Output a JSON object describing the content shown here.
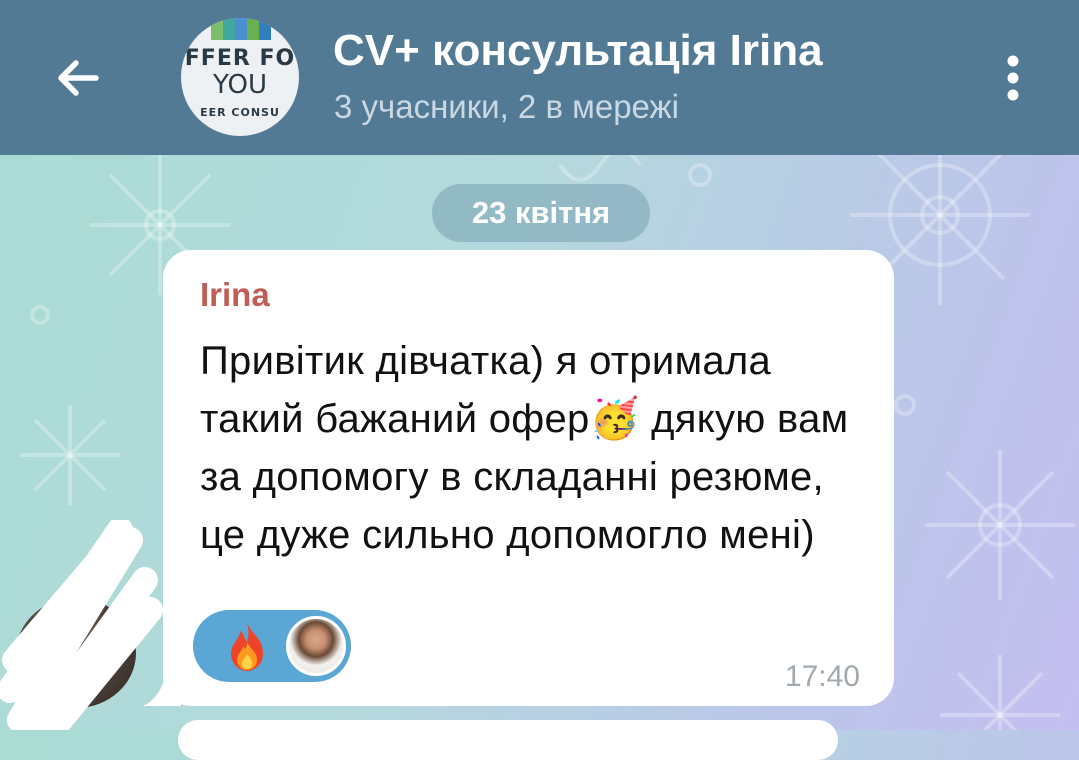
{
  "header": {
    "title": "CV+ консультація Irina",
    "subtitle": "3 учасники, 2 в мережі",
    "back_icon": "arrow-left-icon",
    "menu_icon": "vertical-dots-icon",
    "bg_color": "#527a94",
    "avatar": {
      "line1": "FFER FO",
      "line2": "YOU",
      "line3": "EER CONSU"
    }
  },
  "chat": {
    "date_label": "23 квітня",
    "message": {
      "sender": "Irina",
      "sender_color": "#c05d56",
      "text": "Привітик дівчатка) я отримала такий бажаний офер🥳 дякую вам за допомогу в складанні резюме, це дуже сильно допомогло мені)",
      "time": "17:40",
      "reaction": {
        "icon": "fire-icon",
        "reaction_color": "#5aa7d6"
      }
    }
  }
}
